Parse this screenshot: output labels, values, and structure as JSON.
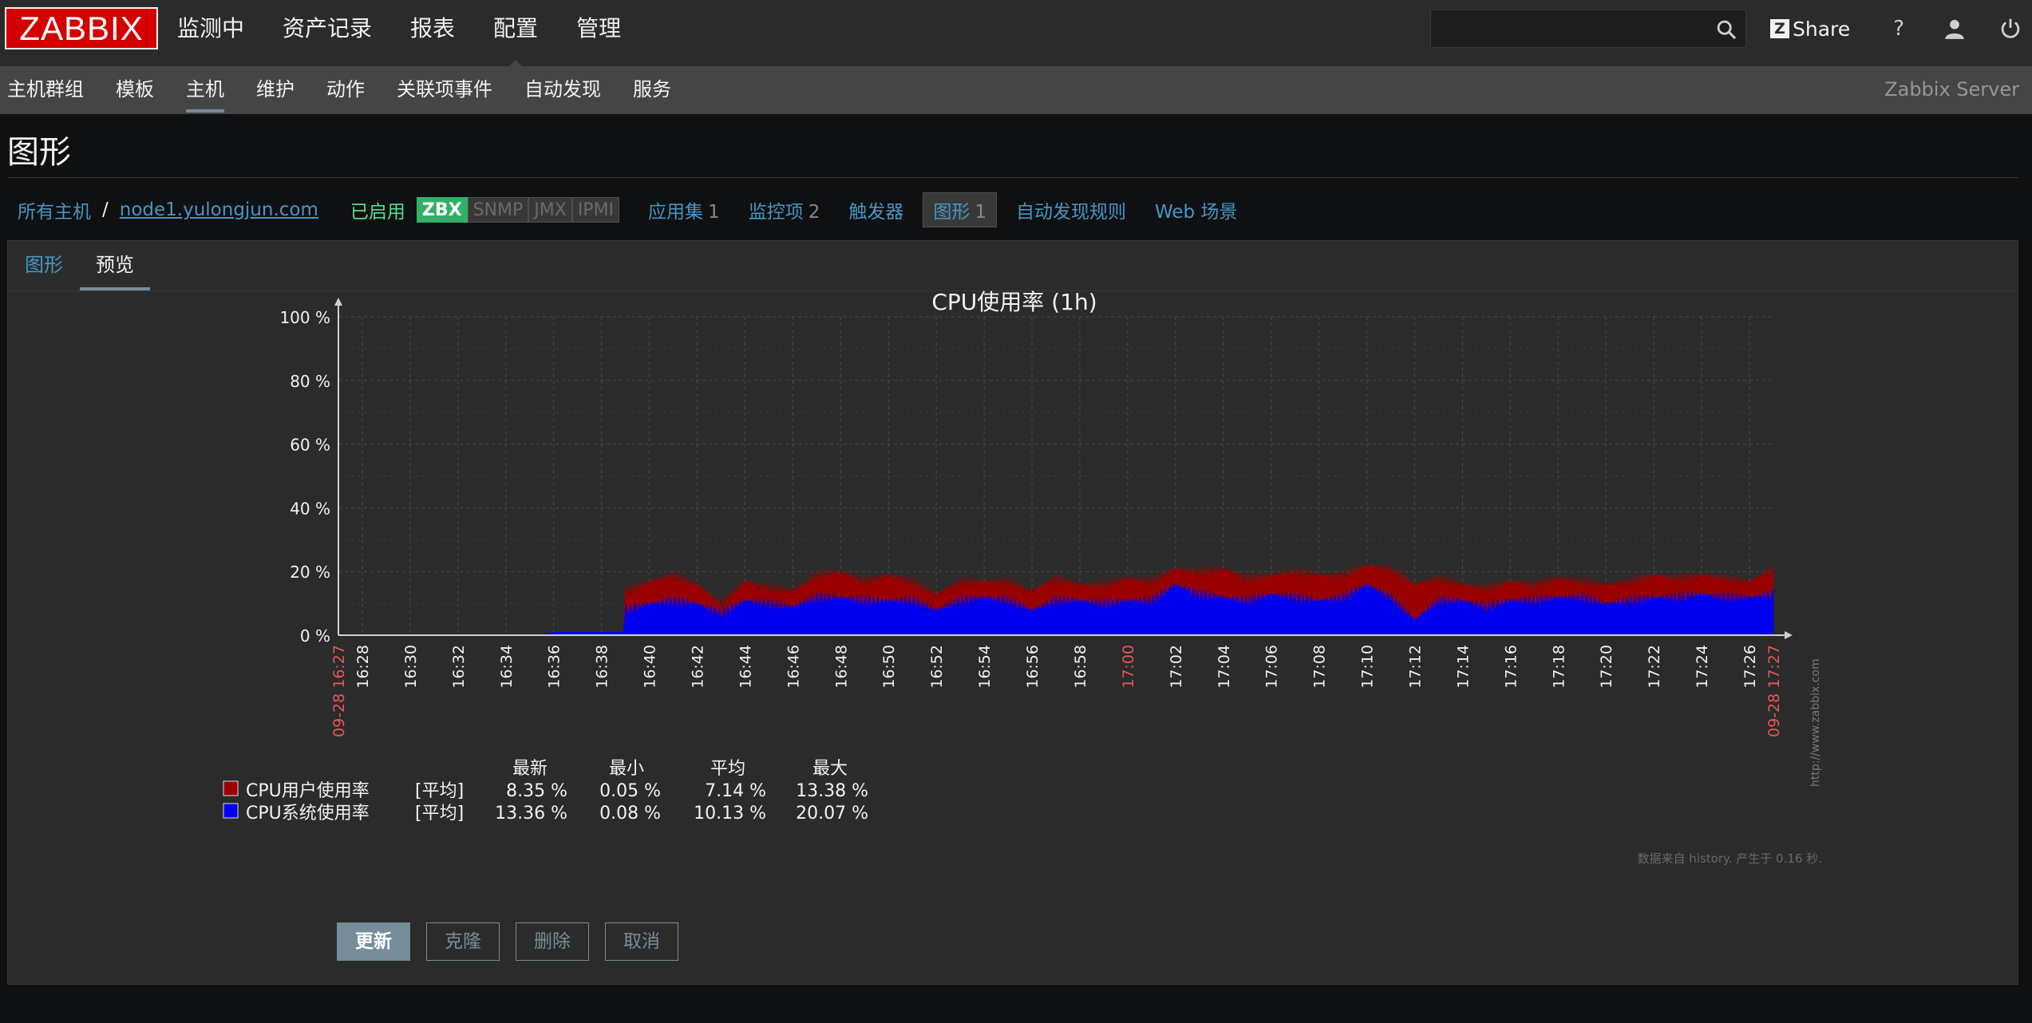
{
  "header": {
    "logo": "ZABBIX",
    "nav": [
      "监测中",
      "资产记录",
      "报表",
      "配置",
      "管理"
    ],
    "active_nav": 3,
    "search_value": "",
    "share_label": "Share",
    "help_icon": "?"
  },
  "subnav": {
    "items": [
      "主机群组",
      "模板",
      "主机",
      "维护",
      "动作",
      "关联项事件",
      "自动发现",
      "服务"
    ],
    "active": 2,
    "server": "Zabbix Server"
  },
  "page": {
    "title": "图形"
  },
  "hostnav": {
    "all_hosts": "所有主机",
    "separator": "/",
    "host": "node1.yulongjun.com",
    "status": "已启用",
    "availability": [
      "ZBX",
      "SNMP",
      "JMX",
      "IPMI"
    ],
    "links": [
      {
        "label": "应用集",
        "count": "1"
      },
      {
        "label": "监控项",
        "count": "2"
      },
      {
        "label": "触发器",
        "count": ""
      },
      {
        "label": "图形",
        "count": "1"
      },
      {
        "label": "自动发现规则",
        "count": ""
      },
      {
        "label": "Web 场景",
        "count": ""
      }
    ]
  },
  "tabs": [
    "图形",
    "预览"
  ],
  "chart_data": {
    "type": "area",
    "title": "CPU使用率 (1h)",
    "y_ticks": [
      "100 %",
      "80 %",
      "60 %",
      "40 %",
      "20 %",
      "0 %"
    ],
    "ylim": [
      0,
      100
    ],
    "x_ticks": [
      "16:28",
      "16:30",
      "16:32",
      "16:34",
      "16:36",
      "16:38",
      "16:40",
      "16:42",
      "16:44",
      "16:46",
      "16:48",
      "16:50",
      "16:52",
      "16:54",
      "16:56",
      "16:58",
      "17:00",
      "17:02",
      "17:04",
      "17:06",
      "17:08",
      "17:10",
      "17:12",
      "17:14",
      "17:16",
      "17:18",
      "17:20",
      "17:22",
      "17:24",
      "17:26"
    ],
    "x_start": "09-28 16:27",
    "x_end": "09-28 17:27",
    "watermark": "http://www.zabbix.com",
    "series": [
      {
        "name": "CPU用户使用率",
        "color": "#990000",
        "agg": "[平均]",
        "last": "8.35 %",
        "min": "0.05 %",
        "avg": "7.14 %",
        "max": "13.38 %",
        "x_minutes": [
          9,
          11.9,
          12,
          13,
          14,
          15,
          16,
          17,
          18,
          19,
          20,
          21,
          22,
          23,
          24,
          25,
          26,
          27,
          28,
          29,
          30,
          31,
          32,
          33,
          34,
          35,
          36,
          37,
          38,
          39,
          40,
          41,
          42,
          43,
          44,
          45,
          46,
          47,
          48,
          49,
          50,
          51,
          52,
          53,
          54,
          55,
          56,
          57,
          58,
          59,
          60
        ],
        "values": [
          0,
          0,
          6,
          7,
          8,
          6,
          3,
          6,
          5,
          5,
          7,
          8,
          6,
          8,
          6,
          5,
          6,
          5,
          6,
          6,
          7,
          5,
          6,
          7,
          6,
          5,
          7,
          9,
          7,
          6,
          8,
          8,
          7,
          6,
          9,
          11,
          7,
          5,
          6,
          6,
          5,
          6,
          5,
          6,
          6,
          7,
          6,
          6,
          6,
          5,
          8
        ]
      },
      {
        "name": "CPU系统使用率",
        "color": "#0000ee",
        "agg": "[平均]",
        "last": "13.36 %",
        "min": "0.08 %",
        "avg": "10.13 %",
        "max": "20.07 %",
        "x_minutes": [
          8.4,
          9,
          11.9,
          12,
          13,
          14,
          15,
          16,
          17,
          18,
          19,
          20,
          21,
          22,
          23,
          24,
          25,
          26,
          27,
          28,
          29,
          30,
          31,
          32,
          33,
          34,
          35,
          36,
          37,
          38,
          39,
          40,
          41,
          42,
          43,
          44,
          45,
          46,
          47,
          48,
          49,
          50,
          51,
          52,
          53,
          54,
          55,
          56,
          57,
          58,
          59,
          60
        ],
        "values": [
          0,
          1,
          1,
          8,
          10,
          11,
          10,
          7,
          11,
          10,
          9,
          12,
          12,
          11,
          11,
          11,
          8,
          11,
          12,
          11,
          8,
          11,
          11,
          10,
          11,
          11,
          16,
          13,
          12,
          11,
          13,
          12,
          11,
          12,
          16,
          12,
          5,
          11,
          11,
          9,
          11,
          11,
          12,
          12,
          10,
          11,
          12,
          12,
          13,
          12,
          12,
          13
        ]
      }
    ],
    "legend_headers": [
      "最新",
      "最小",
      "平均",
      "最大"
    ],
    "footer": "数据来自 history. 产生于 0.16 秒."
  },
  "buttons": {
    "update": "更新",
    "clone": "克隆",
    "delete": "删除",
    "cancel": "取消"
  }
}
